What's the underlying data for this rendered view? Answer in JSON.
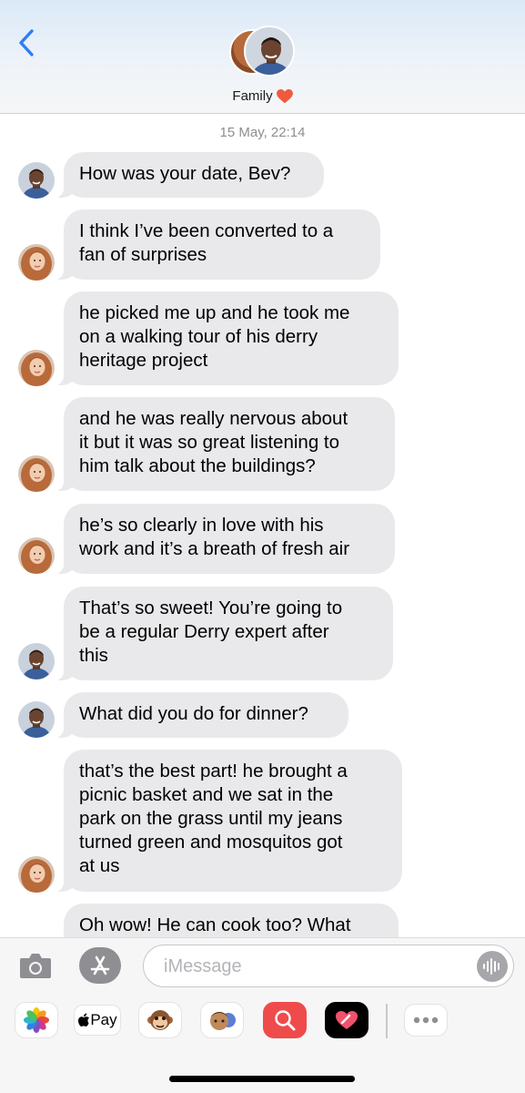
{
  "header": {
    "group_name": "Family"
  },
  "conversation": {
    "timestamp": "15 May, 22:14",
    "messages": [
      {
        "sender": "man",
        "text": "How was your date, Bev?"
      },
      {
        "sender": "woman",
        "text": "I think I’ve been converted to a\nfan of surprises"
      },
      {
        "sender": "woman",
        "text": "he picked me up and he took me\non a walking tour of his derry\nheritage project"
      },
      {
        "sender": "woman",
        "text": "and he was really nervous about\nit but it was so great listening to\nhim talk about the buildings?"
      },
      {
        "sender": "woman",
        "text": "he’s so clearly in love with his\nwork and it’s a breath of fresh air"
      },
      {
        "sender": "man",
        "text": "That’s so sweet! You’re going to\nbe a regular Derry expert after\nthis"
      },
      {
        "sender": "man",
        "text": "What did you do for dinner?"
      },
      {
        "sender": "woman",
        "text": "that’s the best part! he brought a\npicnic basket and we sat in the\npark on the grass until my jeans\nturned green and mosquitos got\nat us"
      },
      {
        "sender": "man",
        "text": "Oh wow! He can cook too? What"
      }
    ]
  },
  "compose": {
    "placeholder": "iMessage",
    "apple_pay_label": "Pay"
  },
  "icons": {
    "back": "chevron-left-icon",
    "camera": "camera-icon",
    "app_store": "app-store-icon",
    "audio": "waveform-icon",
    "photos": "photos-icon",
    "animoji": "monkey-icon",
    "memoji": "memoji-icon",
    "images": "image-search-icon",
    "digital_touch": "heart-touch-icon",
    "more": "more-icon"
  },
  "colors": {
    "accent": "#2f7df6",
    "bubble_gray": "#e9e9eb",
    "heart": "#f05a3c"
  }
}
